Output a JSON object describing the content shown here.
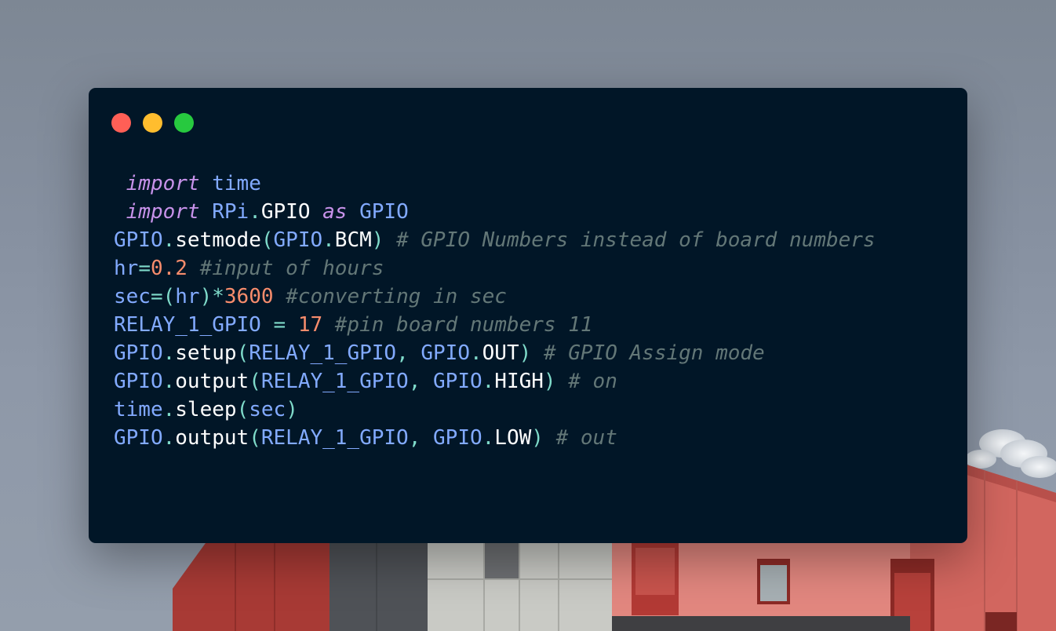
{
  "window": {
    "controls": {
      "close": "red",
      "minimize": "yellow",
      "maximize": "green"
    },
    "colors": {
      "background": "#011627",
      "close": "#ff5f56",
      "minimize": "#ffbd2e",
      "maximize": "#27c93f"
    }
  },
  "code": {
    "language": "python",
    "lines": [
      {
        "tokens": [
          {
            "t": " import",
            "c": "kw"
          },
          {
            "t": " ",
            "c": "plain"
          },
          {
            "t": "time",
            "c": "var"
          }
        ]
      },
      {
        "tokens": [
          {
            "t": " import",
            "c": "kw"
          },
          {
            "t": " ",
            "c": "plain"
          },
          {
            "t": "RPi",
            "c": "var"
          },
          {
            "t": ".",
            "c": "punct"
          },
          {
            "t": "GPIO",
            "c": "fn"
          },
          {
            "t": " ",
            "c": "plain"
          },
          {
            "t": "as",
            "c": "kw"
          },
          {
            "t": " ",
            "c": "plain"
          },
          {
            "t": "GPIO",
            "c": "var"
          }
        ]
      },
      {
        "tokens": [
          {
            "t": "GPIO",
            "c": "var"
          },
          {
            "t": ".",
            "c": "punct"
          },
          {
            "t": "setmode",
            "c": "fn"
          },
          {
            "t": "(",
            "c": "punct"
          },
          {
            "t": "GPIO",
            "c": "var"
          },
          {
            "t": ".",
            "c": "punct"
          },
          {
            "t": "BCM",
            "c": "fn"
          },
          {
            "t": ")",
            "c": "punct"
          },
          {
            "t": " ",
            "c": "plain"
          },
          {
            "t": "# GPIO Numbers instead of board numbers",
            "c": "com"
          }
        ]
      },
      {
        "tokens": [
          {
            "t": "hr",
            "c": "var"
          },
          {
            "t": "=",
            "c": "punct"
          },
          {
            "t": "0.2",
            "c": "num"
          },
          {
            "t": " ",
            "c": "plain"
          },
          {
            "t": "#input of hours",
            "c": "com"
          }
        ]
      },
      {
        "tokens": [
          {
            "t": "sec",
            "c": "var"
          },
          {
            "t": "=(",
            "c": "punct"
          },
          {
            "t": "hr",
            "c": "var"
          },
          {
            "t": ")*",
            "c": "punct"
          },
          {
            "t": "3600",
            "c": "num"
          },
          {
            "t": " ",
            "c": "plain"
          },
          {
            "t": "#converting in sec",
            "c": "com"
          }
        ]
      },
      {
        "tokens": [
          {
            "t": "RELAY_1_GPIO",
            "c": "var"
          },
          {
            "t": " ",
            "c": "plain"
          },
          {
            "t": "=",
            "c": "punct"
          },
          {
            "t": " ",
            "c": "plain"
          },
          {
            "t": "17",
            "c": "num"
          },
          {
            "t": " ",
            "c": "plain"
          },
          {
            "t": "#pin board numbers 11",
            "c": "com"
          }
        ]
      },
      {
        "tokens": [
          {
            "t": "GPIO",
            "c": "var"
          },
          {
            "t": ".",
            "c": "punct"
          },
          {
            "t": "setup",
            "c": "fn"
          },
          {
            "t": "(",
            "c": "punct"
          },
          {
            "t": "RELAY_1_GPIO",
            "c": "var"
          },
          {
            "t": ", ",
            "c": "punct"
          },
          {
            "t": "GPIO",
            "c": "var"
          },
          {
            "t": ".",
            "c": "punct"
          },
          {
            "t": "OUT",
            "c": "fn"
          },
          {
            "t": ")",
            "c": "punct"
          },
          {
            "t": " ",
            "c": "plain"
          },
          {
            "t": "# GPIO Assign mode",
            "c": "com"
          }
        ]
      },
      {
        "tokens": [
          {
            "t": "GPIO",
            "c": "var"
          },
          {
            "t": ".",
            "c": "punct"
          },
          {
            "t": "output",
            "c": "fn"
          },
          {
            "t": "(",
            "c": "punct"
          },
          {
            "t": "RELAY_1_GPIO",
            "c": "var"
          },
          {
            "t": ", ",
            "c": "punct"
          },
          {
            "t": "GPIO",
            "c": "var"
          },
          {
            "t": ".",
            "c": "punct"
          },
          {
            "t": "HIGH",
            "c": "fn"
          },
          {
            "t": ")",
            "c": "punct"
          },
          {
            "t": " ",
            "c": "plain"
          },
          {
            "t": "# on",
            "c": "com"
          }
        ]
      },
      {
        "tokens": [
          {
            "t": "time",
            "c": "var"
          },
          {
            "t": ".",
            "c": "punct"
          },
          {
            "t": "sleep",
            "c": "fn"
          },
          {
            "t": "(",
            "c": "punct"
          },
          {
            "t": "sec",
            "c": "var"
          },
          {
            "t": ")",
            "c": "punct"
          }
        ]
      },
      {
        "tokens": [
          {
            "t": "GPIO",
            "c": "var"
          },
          {
            "t": ".",
            "c": "punct"
          },
          {
            "t": "output",
            "c": "fn"
          },
          {
            "t": "(",
            "c": "punct"
          },
          {
            "t": "RELAY_1_GPIO",
            "c": "var"
          },
          {
            "t": ", ",
            "c": "punct"
          },
          {
            "t": "GPIO",
            "c": "var"
          },
          {
            "t": ".",
            "c": "punct"
          },
          {
            "t": "LOW",
            "c": "fn"
          },
          {
            "t": ")",
            "c": "punct"
          },
          {
            "t": " ",
            "c": "plain"
          },
          {
            "t": "# out",
            "c": "com"
          }
        ]
      }
    ]
  }
}
